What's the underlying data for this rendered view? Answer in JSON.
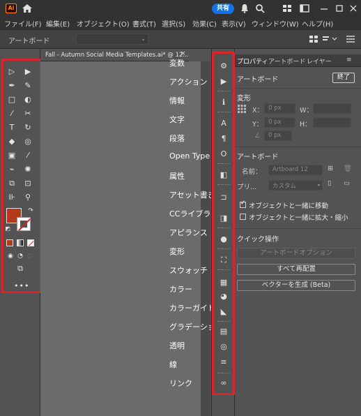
{
  "titlebar": {
    "app_logo": "Ai",
    "share_label": "共有",
    "icons": [
      "home-icon",
      "bell-icon",
      "search-icon",
      "workspace-icon",
      "arrange-icon",
      "minimize-icon",
      "maximize-icon",
      "close-icon"
    ]
  },
  "menubar": {
    "items": [
      {
        "label": "ファイル(F)"
      },
      {
        "label": "編集(E)"
      },
      {
        "label": "オブジェクト(O)"
      },
      {
        "label": "書式(T)"
      },
      {
        "label": "選択(S)"
      },
      {
        "label": "効果(C)"
      },
      {
        "label": "表示(V)"
      },
      {
        "label": "ウィンドウ(W)"
      },
      {
        "label": "ヘルプ(H)"
      }
    ]
  },
  "controlbar": {
    "label": "アートボード"
  },
  "document": {
    "tab_title": "Fall - Autumn Social Media Templates.ai* @ 12...",
    "close_glyph": "×"
  },
  "window_menu_flyout": {
    "items": [
      "変数",
      "アクション",
      "情報",
      "文字",
      "段落",
      "Open Type",
      "属性",
      "アセット書き出し",
      "CCライブラリ",
      "アピランス",
      "変形",
      "スウォッチ",
      "カラー",
      "カラーガイド",
      "グラデーション",
      "透明",
      "線",
      "リンク"
    ]
  },
  "properties_panel": {
    "tabs": [
      "プロパティ",
      "アートボード",
      "レイヤー"
    ],
    "section_artboard": "アートボード",
    "end_button": "終了",
    "transform": {
      "title": "変形",
      "x_label": "X：",
      "y_label": "Y：",
      "w_label": "W：",
      "h_label": "H：",
      "x_value": "0 px",
      "y_value": "0 px",
      "angle_value": "0 px"
    },
    "artboard": {
      "title": "アートボード",
      "name_label": "名前：",
      "name_value": "Artboard 12",
      "preset_label": "プリ...",
      "preset_value": "カスタム"
    },
    "checkboxes": [
      {
        "label": "オブジェクトと一緒に移動",
        "checked": true
      },
      {
        "label": "オブジェクトと一緒に拡大・縮小",
        "checked": false
      }
    ],
    "quick_actions": {
      "title": "クイック操作",
      "artboard_options": "アートボードオプション",
      "rearrange_all": "すべて再配置",
      "generate_vector": "ベクターを生成 (Beta)"
    }
  },
  "colors": {
    "fill": "#b53a1c",
    "highlight_frame": "#d9262a",
    "share": "#1473e6"
  }
}
